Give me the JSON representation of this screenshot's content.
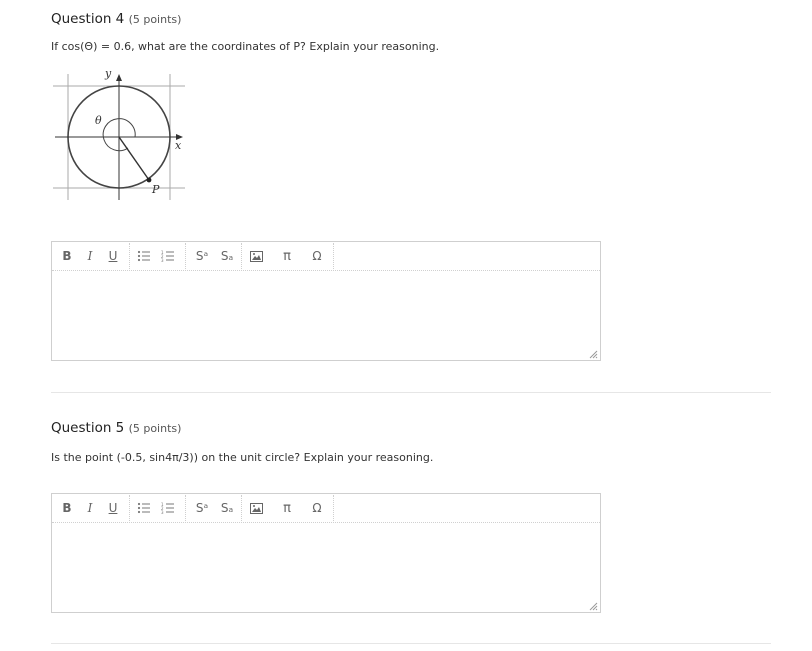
{
  "questions": [
    {
      "title": "Question 4",
      "points": "(5 points)",
      "prompt": "If cos(Θ) = 0.6, what are the coordinates of P? Explain your reasoning.",
      "figure": {
        "y_label": "y",
        "x_label": "x",
        "theta_label": "θ",
        "p_label": "P"
      }
    },
    {
      "title": "Question 5",
      "points": "(5 points)",
      "prompt": "Is the point (-0.5, sin4π/3)) on the unit circle? Explain your reasoning."
    }
  ],
  "toolbar": {
    "bold": "B",
    "italic": "I",
    "underline": "U",
    "bullet_icon": "bulleted-list-icon",
    "numbered_icon": "numbered-list-icon",
    "superscript": "Sᵃ",
    "subscript": "Sₐ",
    "image_icon": "image-icon",
    "pi": "π",
    "omega": "Ω"
  }
}
